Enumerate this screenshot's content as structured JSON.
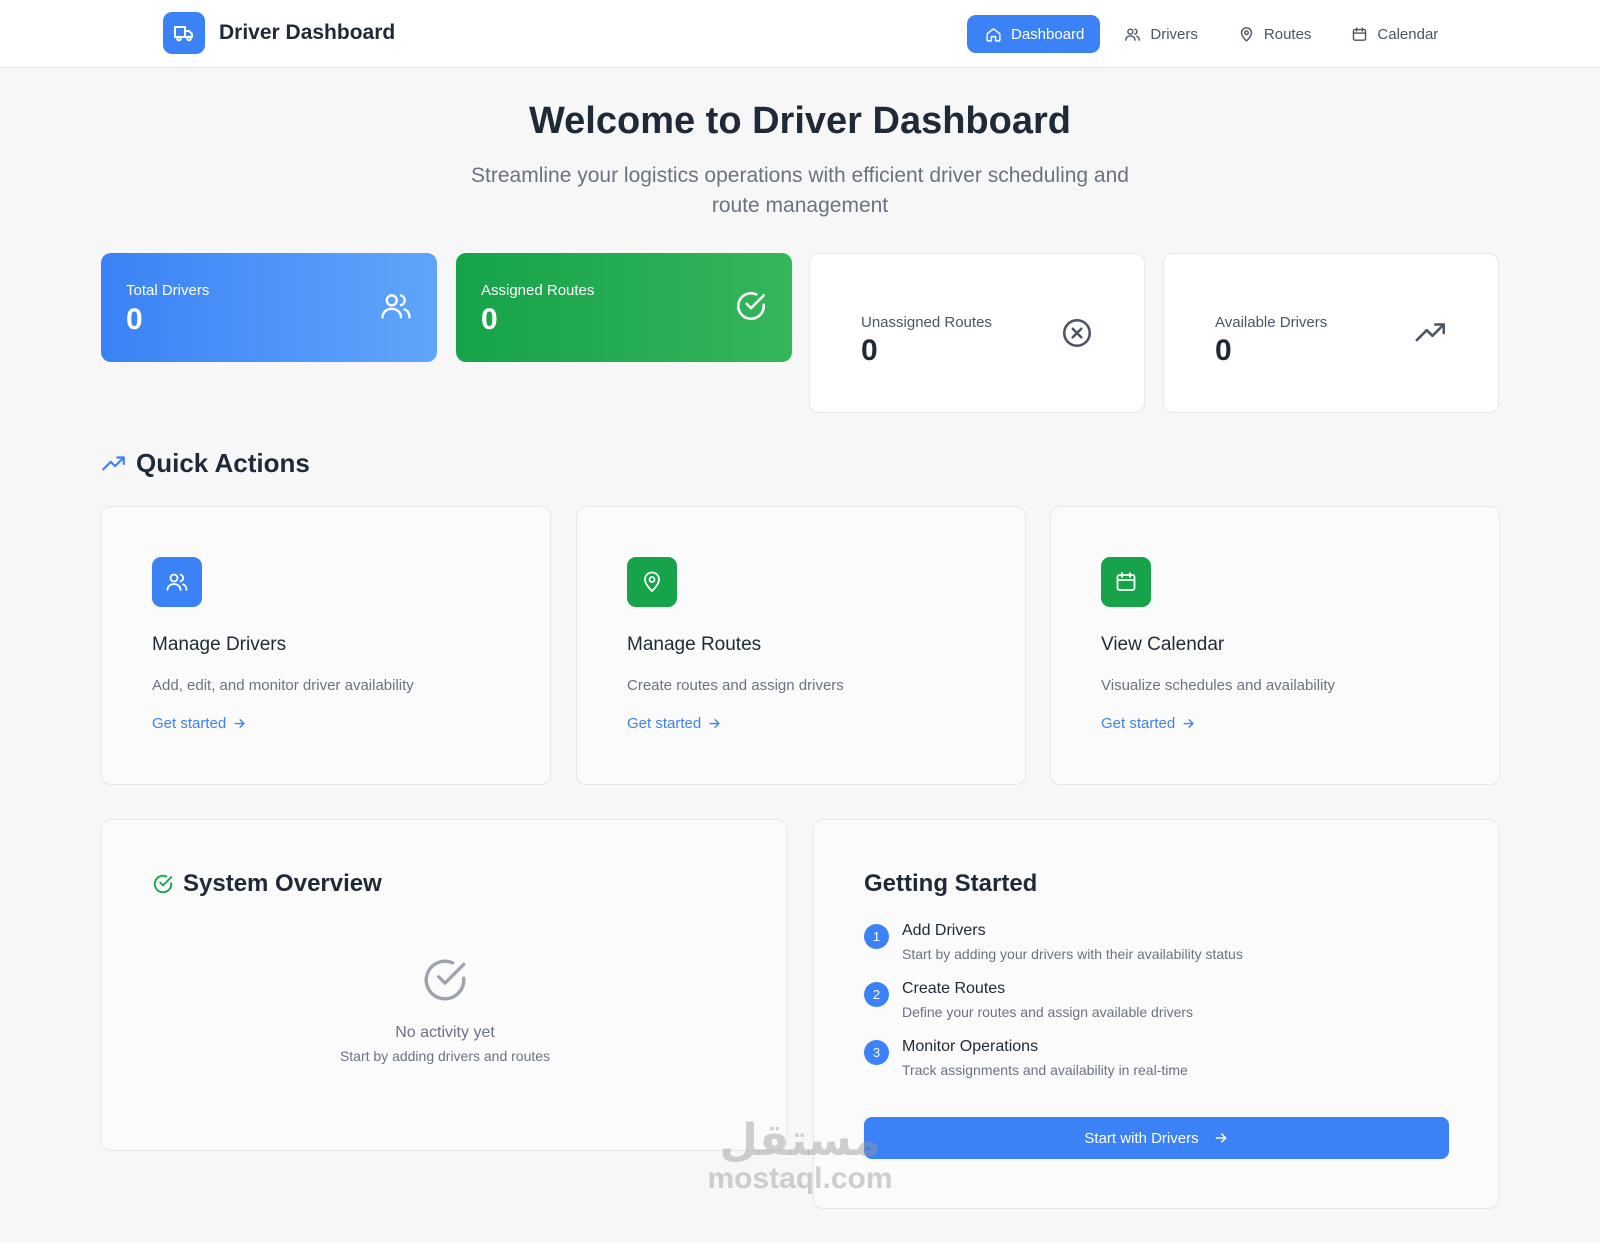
{
  "header": {
    "title": "Driver Dashboard",
    "logo_icon": "truck-icon",
    "nav": [
      {
        "label": "Dashboard",
        "icon": "home-icon",
        "active": true
      },
      {
        "label": "Drivers",
        "icon": "users-icon",
        "active": false
      },
      {
        "label": "Routes",
        "icon": "map-pin-icon",
        "active": false
      },
      {
        "label": "Calendar",
        "icon": "calendar-icon",
        "active": false
      }
    ]
  },
  "hero": {
    "title": "Welcome to Driver Dashboard",
    "subtitle": "Streamline your logistics operations with efficient driver scheduling and route management"
  },
  "stats": [
    {
      "label": "Total Drivers",
      "value": "0",
      "icon": "users-icon",
      "color": "#3b82f6"
    },
    {
      "label": "Assigned Routes",
      "value": "0",
      "icon": "check-circle-icon",
      "color": "#16a34a"
    },
    {
      "label": "Unassigned Routes",
      "value": "0",
      "icon": "x-circle-icon",
      "color": "#ffffff"
    },
    {
      "label": "Available Drivers",
      "value": "0",
      "icon": "trending-up-icon",
      "color": "#ffffff"
    }
  ],
  "quick_actions": {
    "heading": "Quick Actions",
    "items": [
      {
        "title": "Manage Drivers",
        "description": "Add, edit, and monitor driver availability",
        "link": "Get started",
        "icon": "users-icon",
        "color": "#3b82f6"
      },
      {
        "title": "Manage Routes",
        "description": "Create routes and assign drivers",
        "link": "Get started",
        "icon": "map-pin-icon",
        "color": "#16a34a"
      },
      {
        "title": "View Calendar",
        "description": "Visualize schedules and availability",
        "link": "Get started",
        "icon": "calendar-icon",
        "color": "#16a34a"
      }
    ]
  },
  "overview": {
    "heading": "System Overview",
    "empty_title": "No activity yet",
    "empty_subtitle": "Start by adding drivers and routes"
  },
  "getting_started": {
    "heading": "Getting Started",
    "steps": [
      {
        "number": "1",
        "title": "Add Drivers",
        "description": "Start by adding your drivers with their availability status"
      },
      {
        "number": "2",
        "title": "Create Routes",
        "description": "Define your routes and assign available drivers"
      },
      {
        "number": "3",
        "title": "Monitor Operations",
        "description": "Track assignments and availability in real-time"
      }
    ],
    "button_label": "Start with Drivers"
  },
  "watermark": {
    "arabic": "مستقل",
    "latin": "mostaql.com"
  }
}
